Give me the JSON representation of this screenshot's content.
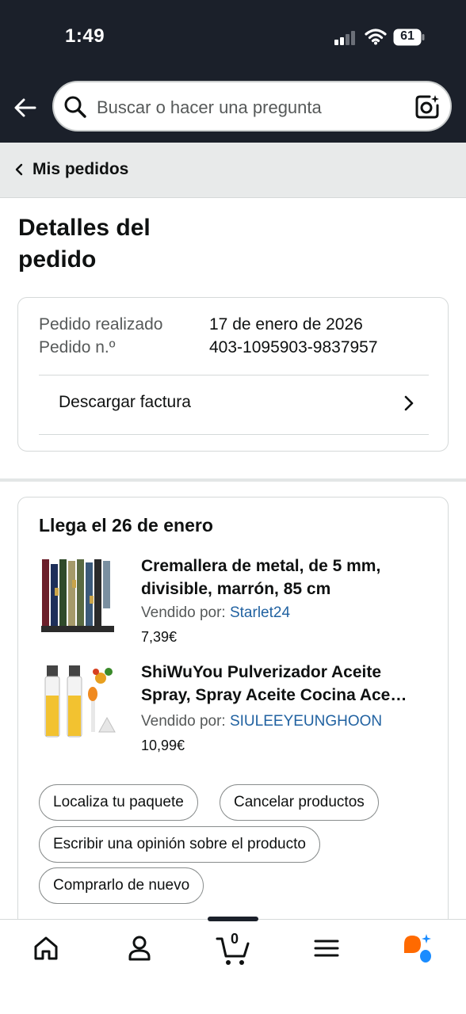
{
  "status_bar": {
    "time": "1:49",
    "battery": "61"
  },
  "search": {
    "placeholder": "Buscar o hacer una pregunta"
  },
  "breadcrumb": {
    "label": "Mis pedidos"
  },
  "page": {
    "title": "Detalles del pedido"
  },
  "order_summary": {
    "placed_label": "Pedido realizado",
    "placed_value": "17 de enero de 2026",
    "number_label": "Pedido n.º",
    "number_value": "403-1095903-9837957",
    "invoice_label": "Descargar factura"
  },
  "shipment": {
    "arrival": "Llega el 26 de enero",
    "seller_prefix": "Vendido por:",
    "items": [
      {
        "title_line1": "Cremallera de metal, de 5 mm,",
        "title_line2": "divisible, marrón, 85 cm",
        "seller": "Starlet24",
        "price": "7,39€"
      },
      {
        "title_line1": "ShiWuYou Pulverizador Aceite",
        "title_line2": "Spray, Spray Aceite Cocina Ace…",
        "seller": "SIULEEYEUNGHOON",
        "price": "10,99€"
      }
    ],
    "actions": {
      "track": "Localiza tu paquete",
      "cancel": "Cancelar productos",
      "review": "Escribir una opinión sobre el producto",
      "buy_again": "Comprarlo de nuevo"
    }
  },
  "bottom_nav": {
    "cart_count": "0"
  },
  "colors": {
    "header_bg": "#1b202a",
    "link": "#2162a1",
    "assistant_orange": "#ff6a00",
    "assistant_blue": "#1a8cff"
  }
}
